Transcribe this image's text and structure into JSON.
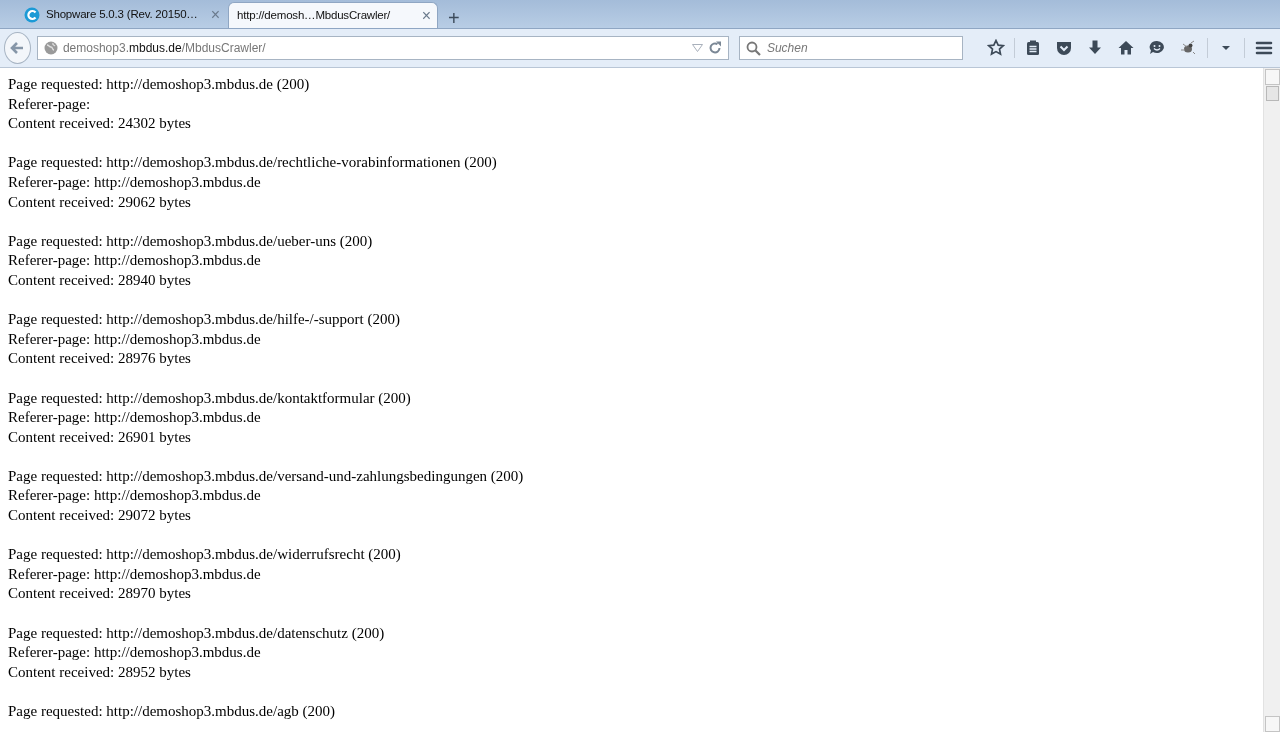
{
  "tabs": [
    {
      "title": "Shopware 5.0.3 (Rev. 20150…",
      "close": "×",
      "selected": false,
      "has_logo": true
    },
    {
      "title": "http://demosh…MbdusCrawler/",
      "close": "×",
      "selected": true,
      "has_logo": false
    }
  ],
  "new_tab": "+",
  "address_bar": {
    "host_sub": "demoshop3.",
    "host_domain": "mbdus.de",
    "path": "/MbdusCrawler/"
  },
  "search": {
    "placeholder": "Suchen"
  },
  "entries": [
    {
      "requested": "Page requested: http://demoshop3.mbdus.de (200)",
      "referer": "Referer-page:",
      "content": "Content received: 24302 bytes"
    },
    {
      "requested": "Page requested: http://demoshop3.mbdus.de/rechtliche-vorabinformationen (200)",
      "referer": "Referer-page: http://demoshop3.mbdus.de",
      "content": "Content received: 29062 bytes"
    },
    {
      "requested": "Page requested: http://demoshop3.mbdus.de/ueber-uns (200)",
      "referer": "Referer-page: http://demoshop3.mbdus.de",
      "content": "Content received: 28940 bytes"
    },
    {
      "requested": "Page requested: http://demoshop3.mbdus.de/hilfe-/-support (200)",
      "referer": "Referer-page: http://demoshop3.mbdus.de",
      "content": "Content received: 28976 bytes"
    },
    {
      "requested": "Page requested: http://demoshop3.mbdus.de/kontaktformular (200)",
      "referer": "Referer-page: http://demoshop3.mbdus.de",
      "content": "Content received: 26901 bytes"
    },
    {
      "requested": "Page requested: http://demoshop3.mbdus.de/versand-und-zahlungsbedingungen (200)",
      "referer": "Referer-page: http://demoshop3.mbdus.de",
      "content": "Content received: 29072 bytes"
    },
    {
      "requested": "Page requested: http://demoshop3.mbdus.de/widerrufsrecht (200)",
      "referer": "Referer-page: http://demoshop3.mbdus.de",
      "content": "Content received: 28970 bytes"
    },
    {
      "requested": "Page requested: http://demoshop3.mbdus.de/datenschutz (200)",
      "referer": "Referer-page: http://demoshop3.mbdus.de",
      "content": "Content received: 28952 bytes"
    },
    {
      "requested": "Page requested: http://demoshop3.mbdus.de/agb (200)"
    }
  ]
}
